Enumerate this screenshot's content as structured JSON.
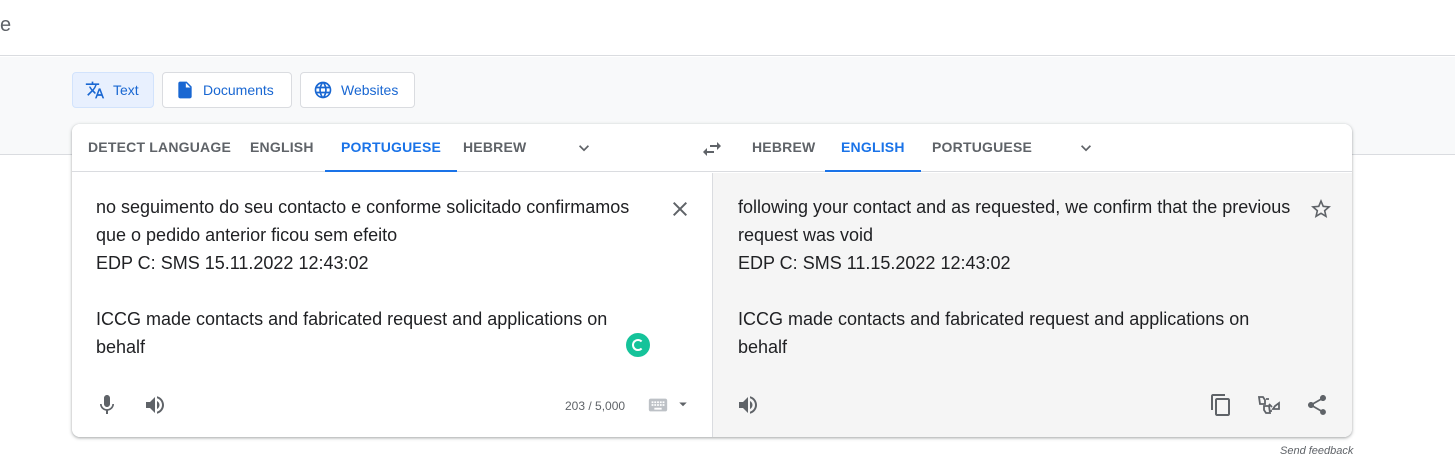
{
  "header": {
    "logo_fragment": "e"
  },
  "modes": [
    {
      "label": "Text",
      "icon": "translate-icon",
      "active": true
    },
    {
      "label": "Documents",
      "icon": "document-icon",
      "active": false
    },
    {
      "label": "Websites",
      "icon": "globe-icon",
      "active": false
    }
  ],
  "source_languages": [
    "DETECT LANGUAGE",
    "ENGLISH",
    "PORTUGUESE",
    "HEBREW"
  ],
  "source_selected": "PORTUGUESE",
  "target_languages": [
    "HEBREW",
    "ENGLISH",
    "PORTUGUESE"
  ],
  "target_selected": "ENGLISH",
  "source": {
    "text": "no seguimento do seu contacto e conforme solicitado confirmamos\nque o pedido anterior ficou sem efeito\nEDP C: SMS 15.11.2022 12:43:02\n\nICCG made contacts and fabricated request and applications on\nbehalf",
    "char_count": "203 / 5,000"
  },
  "target": {
    "text": "following your contact and as requested, we confirm that the previous\nrequest was void\nEDP C: SMS 11.15.2022 12:43:02\n\nICCG made contacts and fabricated request and applications on\nbehalf"
  },
  "footer": {
    "send_feedback": "Send feedback"
  },
  "colors": {
    "accent": "#1a73e8",
    "grammarly": "#15c39a"
  }
}
